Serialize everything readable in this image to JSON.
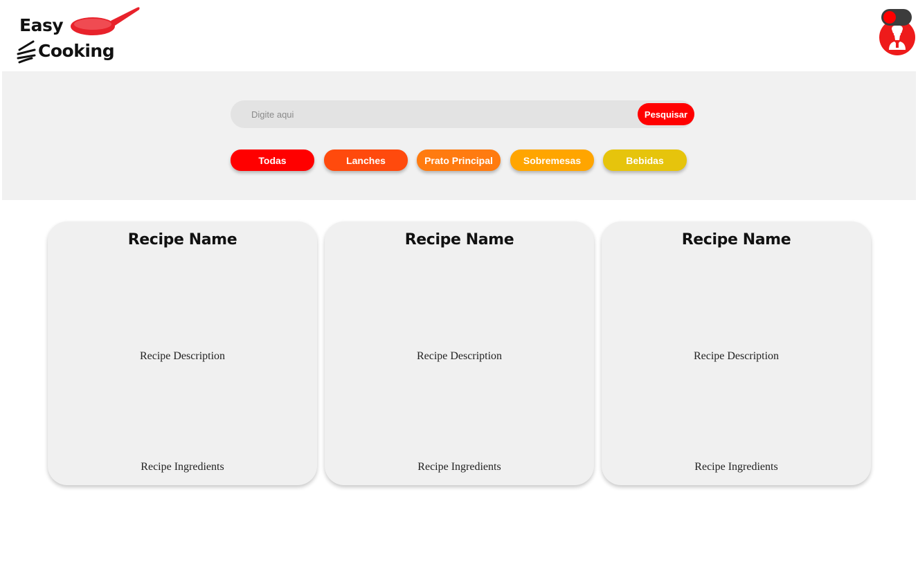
{
  "header": {
    "logo": {
      "word1": "Easy",
      "word2": "Cooking",
      "icon": "frying-pan-icon",
      "accent": "#e8222b"
    },
    "theme_toggle": {
      "state": "on",
      "knob_color": "#ff0000"
    },
    "avatar": {
      "icon": "chef-icon",
      "color": "#ee1b1b"
    }
  },
  "search": {
    "placeholder": "Digite aqui",
    "value": "",
    "button_label": "Pesquisar",
    "button_color": "#ff0000"
  },
  "categories": [
    {
      "label": "Todas",
      "color": "#ff0000"
    },
    {
      "label": "Lanches",
      "color": "#ff4a0d"
    },
    {
      "label": "Prato Principal",
      "color": "#ff7b10"
    },
    {
      "label": "Sobremesas",
      "color": "#ffa500"
    },
    {
      "label": "Bebidas",
      "color": "#e6c40c"
    }
  ],
  "recipes": [
    {
      "name": "Recipe Name",
      "description": "Recipe Description",
      "ingredients": "Recipe Ingredients"
    },
    {
      "name": "Recipe Name",
      "description": "Recipe Description",
      "ingredients": "Recipe Ingredients"
    },
    {
      "name": "Recipe Name",
      "description": "Recipe Description",
      "ingredients": "Recipe Ingredients"
    }
  ]
}
